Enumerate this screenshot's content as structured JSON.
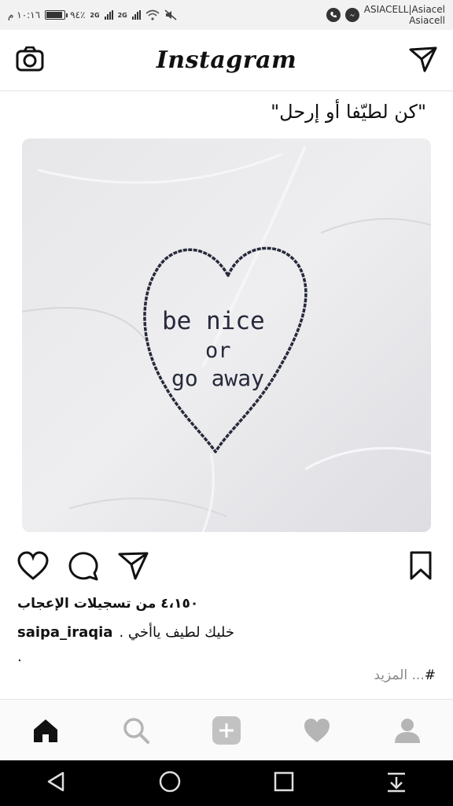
{
  "status_bar": {
    "time": "١٠:١٦ م",
    "battery": "٩٤٪",
    "battery_level": 0.94,
    "network_1": "2G",
    "network_2": "2G",
    "carrier_line1": "ASIACELL|Asiacel",
    "carrier_line2": "Asiacell"
  },
  "header": {
    "logo": "Instagram",
    "camera_icon": "camera-icon",
    "direct_icon": "paper-plane-icon"
  },
  "post": {
    "caption_top": "\"كن لطيّفا أو إرحل\"",
    "image_text": {
      "line1": "be nice",
      "line2": "or",
      "line3": "go away"
    },
    "likes": "٤،١٥٠ من تسجيلات الإعجاب",
    "username": "saipa_iraqia",
    "caption": "خليك لطيف ياأخي .",
    "dot": ".",
    "more_hash": "#",
    "more": "... المزيد"
  },
  "bottom_nav": {
    "items": [
      "home-icon",
      "search-icon",
      "add-icon",
      "heart-icon",
      "profile-icon"
    ]
  },
  "colors": {
    "status_bg": "#f2f2f2",
    "nav_inactive": "#b5b5b5"
  }
}
